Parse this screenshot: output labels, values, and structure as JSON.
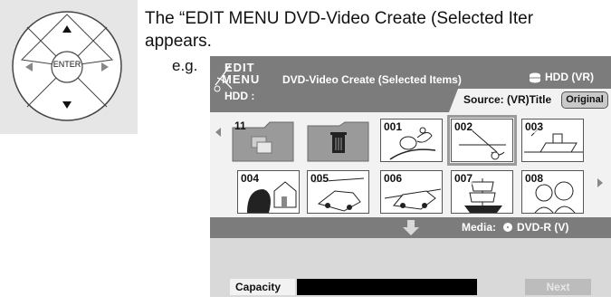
{
  "remote": {
    "enter_label": "ENTER",
    "arrows": [
      "up-arrow",
      "down-arrow",
      "left-arrow",
      "right-arrow"
    ]
  },
  "instruction": {
    "line1": "The “EDIT MENU DVD-Video Create (Selected Iter",
    "line2": "appears."
  },
  "example_label": "e.g.",
  "screen": {
    "logo_line1": "EDIT",
    "logo_line2": "MENU",
    "title": "DVD-Video Create (Selected Items)",
    "drive_badge": "HDD (VR)",
    "source_drive": "HDD :",
    "source": "Source: (VR)Title",
    "original_button": "Original",
    "thumbnails_row1": [
      {
        "num": "11",
        "kind": "folder",
        "selected": false
      },
      {
        "num": "",
        "kind": "trash",
        "selected": false
      },
      {
        "num": "001",
        "kind": "bird",
        "selected": false
      },
      {
        "num": "002",
        "kind": "fishing",
        "selected": true
      },
      {
        "num": "003",
        "kind": "ship",
        "selected": false
      }
    ],
    "thumbnails_row2": [
      {
        "num": "004",
        "kind": "house",
        "selected": false
      },
      {
        "num": "005",
        "kind": "car",
        "selected": false
      },
      {
        "num": "006",
        "kind": "car2",
        "selected": false
      },
      {
        "num": "007",
        "kind": "sailship",
        "selected": false
      },
      {
        "num": "008",
        "kind": "people",
        "selected": false
      }
    ],
    "media_label": "Media:",
    "media_value": "DVD-R (V)",
    "capacity_label": "Capacity",
    "next_button": "Next"
  },
  "colors": {
    "header_gray": "#7c7c7c",
    "panel_light": "#f2f2f2",
    "screen_bg": "#d9d9d9",
    "pad_bg": "#e6e6e6"
  }
}
